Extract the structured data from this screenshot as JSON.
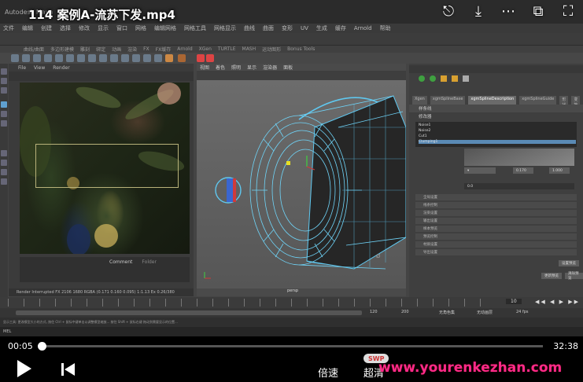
{
  "video": {
    "title": "114 案例A-流苏下发.mp4",
    "current_time": "00:05",
    "total_time": "32:38",
    "progress": 0.005,
    "speed_label": "倍速",
    "quality_label": "超清",
    "swp_label": "SWP",
    "watermark": "www.yourenkezhan.com",
    "icons": [
      "share-icon",
      "download-icon",
      "more-icon",
      "pip-icon",
      "fullscreen-icon"
    ]
  },
  "maya": {
    "window_title": "Autodesk Maya",
    "menus": [
      "文件",
      "编辑",
      "创建",
      "选择",
      "修改",
      "显示",
      "窗口",
      "网格",
      "编辑网格",
      "网格工具",
      "网格显示",
      "曲线",
      "曲面",
      "变形",
      "UV",
      "生成",
      "缓存",
      "Arnold",
      "帮助"
    ],
    "shelf_tabs": [
      "曲线/曲面",
      "多边形建模",
      "雕刻",
      "绑定",
      "动画",
      "渲染",
      "FX",
      "FX缓存",
      "Arnold",
      "XGen",
      "TURTLE",
      "MASH",
      "运动图形",
      "Bonus Tools"
    ],
    "render_view": {
      "menus": [
        "File",
        "View",
        "Render"
      ],
      "comment_tabs": [
        "Comment",
        "Folder"
      ],
      "status": "Render Interrupted FX 2106 1680 RGBA (0.171 0.160 0.095)   1:1.13 Ex 0.26/380"
    },
    "viewport": {
      "menus": [
        "视图",
        "着色",
        "照明",
        "显示",
        "渲染器",
        "面板"
      ],
      "camera_label": "persp"
    },
    "attribute_editor": {
      "tabs": [
        "Xgen",
        "xgmSplineBase",
        "xgmSplineDescription",
        "xgmSplineGuide",
        "形状",
        "变换",
        "描述",
        "节点"
      ],
      "header_label": "样条线",
      "modifier_section": "修改器",
      "list_items": [
        "Noise1",
        "Noise2",
        "Cut1",
        "Clumping1"
      ],
      "selected_item": "Clumping1",
      "field_value_a": "0.170",
      "field_value_b": "1.000",
      "density_value": "0.0",
      "sections": [
        "全局设置",
        "线条控制",
        "渲染设置",
        "输出设置",
        "样本预览",
        "预览控制",
        "材质设置",
        "导出设置"
      ],
      "buttons": [
        "设置预览",
        "更新预览",
        "清除预览"
      ]
    },
    "timeline": {
      "end_frame": "10",
      "range_end": "120",
      "range_total": "200",
      "char_set": "无角色集",
      "anim_layer": "无动画层",
      "fps": "24 fps"
    },
    "cmd_line": "显示工具: 更改模型大小的方式, 按住 Ctrl + 鼠标中键单击以调整模型缩放...  按住 Shift + 鼠标右键 拖动到需要显示的位置...",
    "mel_label": "MEL"
  }
}
